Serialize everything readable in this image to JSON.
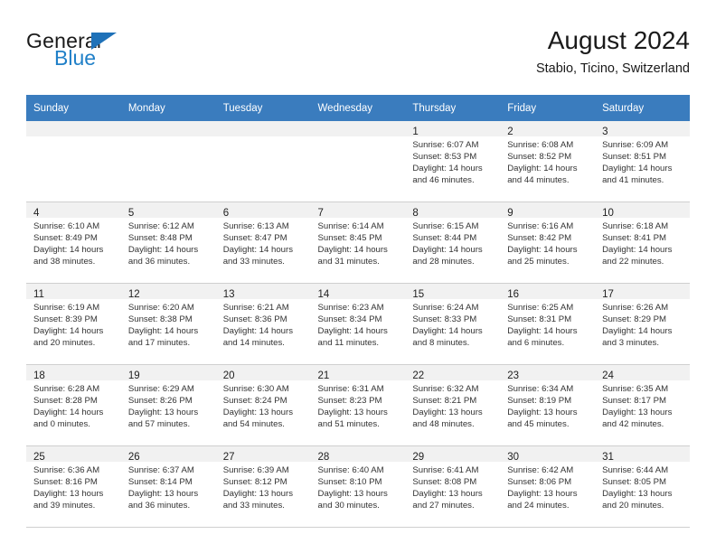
{
  "brand": {
    "word_one": "General",
    "word_two": "Blue",
    "triangle_color": "#1e71b8",
    "blue_color": "#2080c8"
  },
  "header": {
    "month_title": "August 2024",
    "location": "Stabio, Ticino, Switzerland"
  },
  "theme": {
    "header_bg": "#3a7cbe",
    "header_text": "#ffffff",
    "daynum_band": "#f1f1f1",
    "grid_line": "#cfcfcf"
  },
  "weekday_headers": [
    "Sunday",
    "Monday",
    "Tuesday",
    "Wednesday",
    "Thursday",
    "Friday",
    "Saturday"
  ],
  "weeks": [
    [
      {
        "day": "",
        "lines": []
      },
      {
        "day": "",
        "lines": []
      },
      {
        "day": "",
        "lines": []
      },
      {
        "day": "",
        "lines": []
      },
      {
        "day": "1",
        "lines": [
          "Sunrise: 6:07 AM",
          "Sunset: 8:53 PM",
          "Daylight: 14 hours",
          "and 46 minutes."
        ]
      },
      {
        "day": "2",
        "lines": [
          "Sunrise: 6:08 AM",
          "Sunset: 8:52 PM",
          "Daylight: 14 hours",
          "and 44 minutes."
        ]
      },
      {
        "day": "3",
        "lines": [
          "Sunrise: 6:09 AM",
          "Sunset: 8:51 PM",
          "Daylight: 14 hours",
          "and 41 minutes."
        ]
      }
    ],
    [
      {
        "day": "4",
        "lines": [
          "Sunrise: 6:10 AM",
          "Sunset: 8:49 PM",
          "Daylight: 14 hours",
          "and 38 minutes."
        ]
      },
      {
        "day": "5",
        "lines": [
          "Sunrise: 6:12 AM",
          "Sunset: 8:48 PM",
          "Daylight: 14 hours",
          "and 36 minutes."
        ]
      },
      {
        "day": "6",
        "lines": [
          "Sunrise: 6:13 AM",
          "Sunset: 8:47 PM",
          "Daylight: 14 hours",
          "and 33 minutes."
        ]
      },
      {
        "day": "7",
        "lines": [
          "Sunrise: 6:14 AM",
          "Sunset: 8:45 PM",
          "Daylight: 14 hours",
          "and 31 minutes."
        ]
      },
      {
        "day": "8",
        "lines": [
          "Sunrise: 6:15 AM",
          "Sunset: 8:44 PM",
          "Daylight: 14 hours",
          "and 28 minutes."
        ]
      },
      {
        "day": "9",
        "lines": [
          "Sunrise: 6:16 AM",
          "Sunset: 8:42 PM",
          "Daylight: 14 hours",
          "and 25 minutes."
        ]
      },
      {
        "day": "10",
        "lines": [
          "Sunrise: 6:18 AM",
          "Sunset: 8:41 PM",
          "Daylight: 14 hours",
          "and 22 minutes."
        ]
      }
    ],
    [
      {
        "day": "11",
        "lines": [
          "Sunrise: 6:19 AM",
          "Sunset: 8:39 PM",
          "Daylight: 14 hours",
          "and 20 minutes."
        ]
      },
      {
        "day": "12",
        "lines": [
          "Sunrise: 6:20 AM",
          "Sunset: 8:38 PM",
          "Daylight: 14 hours",
          "and 17 minutes."
        ]
      },
      {
        "day": "13",
        "lines": [
          "Sunrise: 6:21 AM",
          "Sunset: 8:36 PM",
          "Daylight: 14 hours",
          "and 14 minutes."
        ]
      },
      {
        "day": "14",
        "lines": [
          "Sunrise: 6:23 AM",
          "Sunset: 8:34 PM",
          "Daylight: 14 hours",
          "and 11 minutes."
        ]
      },
      {
        "day": "15",
        "lines": [
          "Sunrise: 6:24 AM",
          "Sunset: 8:33 PM",
          "Daylight: 14 hours",
          "and 8 minutes."
        ]
      },
      {
        "day": "16",
        "lines": [
          "Sunrise: 6:25 AM",
          "Sunset: 8:31 PM",
          "Daylight: 14 hours",
          "and 6 minutes."
        ]
      },
      {
        "day": "17",
        "lines": [
          "Sunrise: 6:26 AM",
          "Sunset: 8:29 PM",
          "Daylight: 14 hours",
          "and 3 minutes."
        ]
      }
    ],
    [
      {
        "day": "18",
        "lines": [
          "Sunrise: 6:28 AM",
          "Sunset: 8:28 PM",
          "Daylight: 14 hours",
          "and 0 minutes."
        ]
      },
      {
        "day": "19",
        "lines": [
          "Sunrise: 6:29 AM",
          "Sunset: 8:26 PM",
          "Daylight: 13 hours",
          "and 57 minutes."
        ]
      },
      {
        "day": "20",
        "lines": [
          "Sunrise: 6:30 AM",
          "Sunset: 8:24 PM",
          "Daylight: 13 hours",
          "and 54 minutes."
        ]
      },
      {
        "day": "21",
        "lines": [
          "Sunrise: 6:31 AM",
          "Sunset: 8:23 PM",
          "Daylight: 13 hours",
          "and 51 minutes."
        ]
      },
      {
        "day": "22",
        "lines": [
          "Sunrise: 6:32 AM",
          "Sunset: 8:21 PM",
          "Daylight: 13 hours",
          "and 48 minutes."
        ]
      },
      {
        "day": "23",
        "lines": [
          "Sunrise: 6:34 AM",
          "Sunset: 8:19 PM",
          "Daylight: 13 hours",
          "and 45 minutes."
        ]
      },
      {
        "day": "24",
        "lines": [
          "Sunrise: 6:35 AM",
          "Sunset: 8:17 PM",
          "Daylight: 13 hours",
          "and 42 minutes."
        ]
      }
    ],
    [
      {
        "day": "25",
        "lines": [
          "Sunrise: 6:36 AM",
          "Sunset: 8:16 PM",
          "Daylight: 13 hours",
          "and 39 minutes."
        ]
      },
      {
        "day": "26",
        "lines": [
          "Sunrise: 6:37 AM",
          "Sunset: 8:14 PM",
          "Daylight: 13 hours",
          "and 36 minutes."
        ]
      },
      {
        "day": "27",
        "lines": [
          "Sunrise: 6:39 AM",
          "Sunset: 8:12 PM",
          "Daylight: 13 hours",
          "and 33 minutes."
        ]
      },
      {
        "day": "28",
        "lines": [
          "Sunrise: 6:40 AM",
          "Sunset: 8:10 PM",
          "Daylight: 13 hours",
          "and 30 minutes."
        ]
      },
      {
        "day": "29",
        "lines": [
          "Sunrise: 6:41 AM",
          "Sunset: 8:08 PM",
          "Daylight: 13 hours",
          "and 27 minutes."
        ]
      },
      {
        "day": "30",
        "lines": [
          "Sunrise: 6:42 AM",
          "Sunset: 8:06 PM",
          "Daylight: 13 hours",
          "and 24 minutes."
        ]
      },
      {
        "day": "31",
        "lines": [
          "Sunrise: 6:44 AM",
          "Sunset: 8:05 PM",
          "Daylight: 13 hours",
          "and 20 minutes."
        ]
      }
    ]
  ]
}
